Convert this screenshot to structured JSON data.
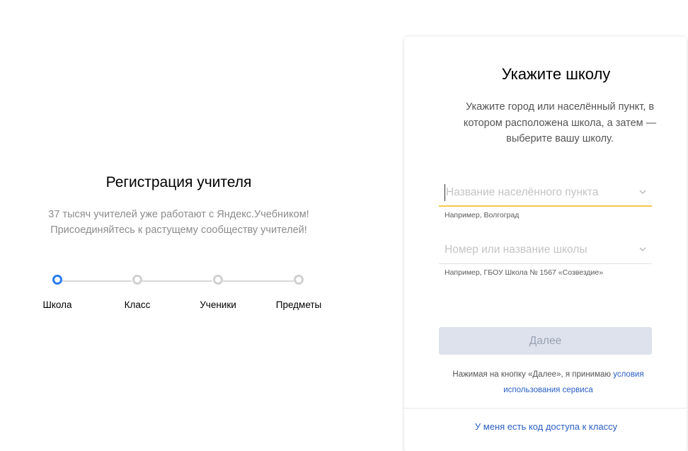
{
  "registration": {
    "title": "Регистрация учителя",
    "description_line1": "37 тысяч учителей уже работают с Яндекс.Учебником!",
    "description_line2": "Присоединяйтесь к растущему сообществу учителей!",
    "steps": [
      {
        "label": "Школа",
        "state": "active"
      },
      {
        "label": "Класс",
        "state": "inactive"
      },
      {
        "label": "Ученики",
        "state": "inactive"
      },
      {
        "label": "Предметы",
        "state": "inactive"
      }
    ]
  },
  "school_form": {
    "title": "Укажите школу",
    "description": "Укажите город или населённый пункт, в котором расположена школа, а затем — выберите вашу школу.",
    "city_field": {
      "value": "",
      "placeholder": "Название населённого пункта",
      "hint": "Например, Волгоград"
    },
    "school_field": {
      "value": "",
      "placeholder": "Номер или название школы",
      "hint": "Например, ГБОУ Школа № 1567 «Созвездие»"
    },
    "next_button": "Далее",
    "terms_text": "Нажимая на кнопку «Далее», я принимаю ",
    "terms_link": "условия использования сервиса",
    "access_code_link": "У меня есть код доступа к классу"
  },
  "colors": {
    "accent": "#2a7cf0",
    "link": "#2a5fc4",
    "focus_underline": "#f2c94c",
    "button_disabled_bg": "#dde2ec"
  }
}
